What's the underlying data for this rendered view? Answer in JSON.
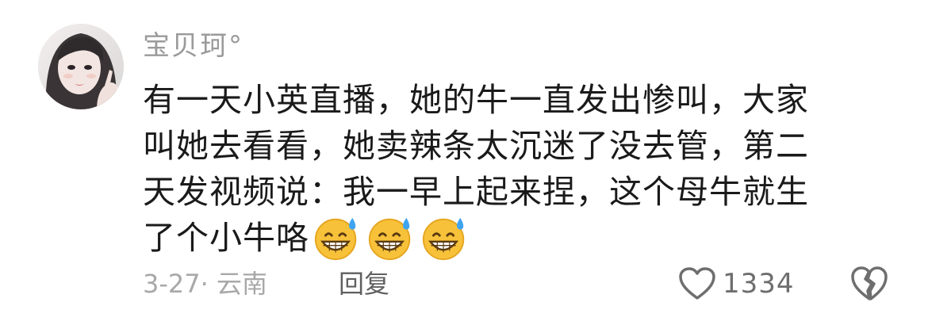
{
  "comment": {
    "username": "宝贝珂°",
    "text_lines": [
      "有一天小英直播，她的牛一直发出惨叫，大家",
      "叫她去看看，她卖辣条太沉迷了没去管，第二",
      "天发视频说：我一早上起来捏，这个母牛就生",
      "了个小牛咯"
    ],
    "emojis": [
      "grinning-sweat-emoji",
      "grinning-sweat-emoji",
      "grinning-sweat-emoji"
    ],
    "date_location": "3-27· 云南",
    "reply_label": "回复",
    "like_count": "1334"
  },
  "colors": {
    "username": "#9a9a9a",
    "text": "#1a1a1a",
    "meta": "#a8a8a8",
    "reply": "#5f5f5f",
    "icon": "#6e6e6e"
  },
  "icons": {
    "like": "heart-outline-icon",
    "dislike": "broken-heart-outline-icon"
  }
}
